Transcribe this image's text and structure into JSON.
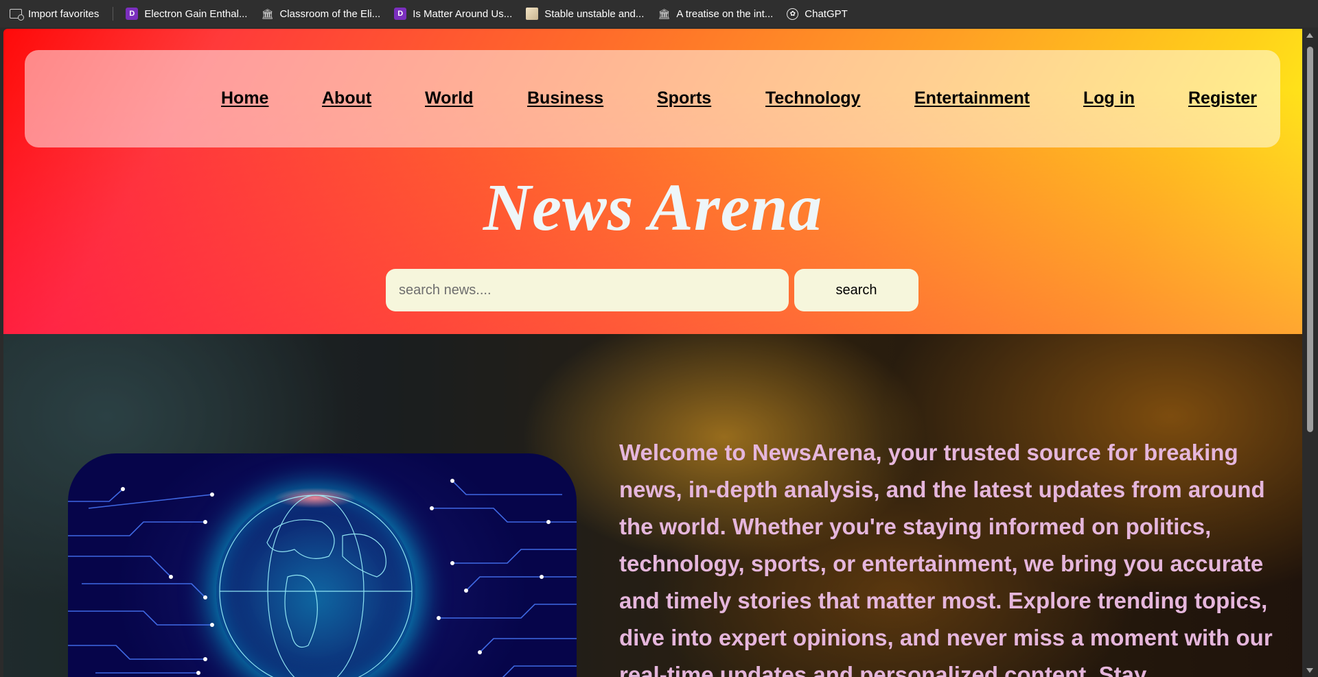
{
  "favorites_bar": {
    "items": [
      {
        "label": "Import favorites",
        "icon": "import-favorites-icon"
      },
      {
        "label": "Electron Gain Enthal...",
        "icon": "bookmark-purple-icon"
      },
      {
        "label": "Classroom of the Eli...",
        "icon": "bank-icon"
      },
      {
        "label": "Is Matter Around Us...",
        "icon": "bookmark-purple-icon"
      },
      {
        "label": "Stable unstable and...",
        "icon": "image-thumbnail-icon"
      },
      {
        "label": "A treatise on the int...",
        "icon": "bank-icon"
      },
      {
        "label": "ChatGPT",
        "icon": "chatgpt-icon"
      }
    ]
  },
  "nav": {
    "links": [
      "Home",
      "About",
      "World",
      "Business",
      "Sports",
      "Technology",
      "Entertainment",
      "Log in",
      "Register"
    ]
  },
  "header": {
    "title": "News Arena",
    "gradient_colors": [
      "#ff0a0a",
      "#ff6a2a",
      "#ffa024",
      "#ffff1a"
    ]
  },
  "search": {
    "placeholder": "search news....",
    "value": "",
    "button_label": "search"
  },
  "hero": {
    "image_icon": "digital-globe-image",
    "welcome_text": "Welcome to NewsArena, your trusted source for breaking news, in-depth analysis, and the latest updates from around the world. Whether you're staying informed on politics, technology, sports, or entertainment, we bring you accurate and timely stories that matter most. Explore trending topics, dive into expert opinions, and never miss a moment with our real-time updates and personalized content. Stay",
    "text_color": "#e5b6dc"
  }
}
